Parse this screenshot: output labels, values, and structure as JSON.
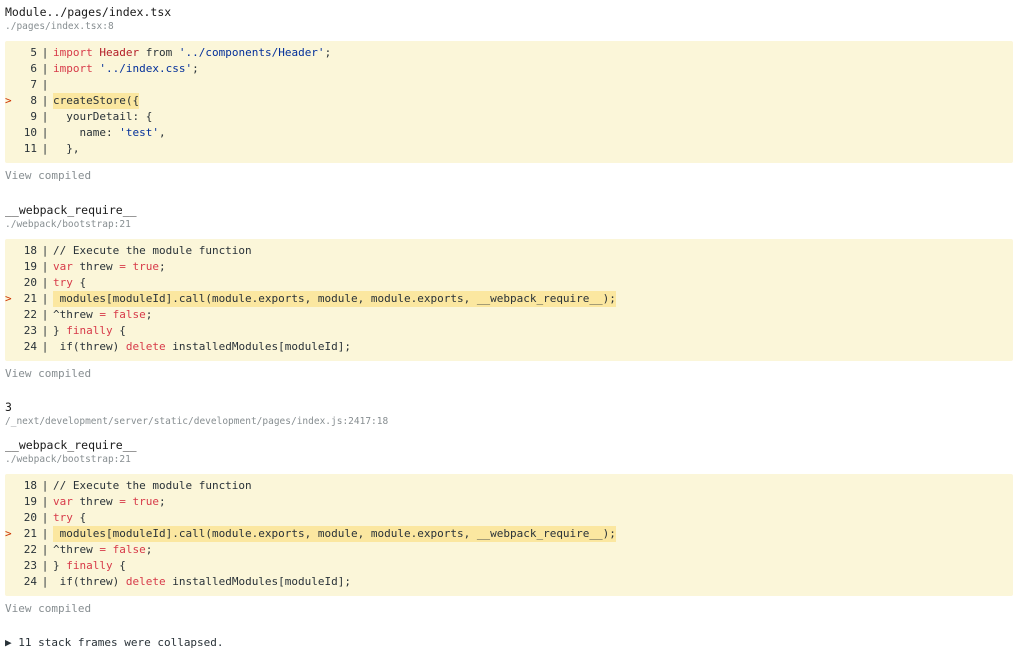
{
  "frames": [
    {
      "title": "Module../pages/index.tsx",
      "location": "./pages/index.tsx:8",
      "lines": [
        {
          "num": "5",
          "highlighted": false,
          "tokens": [
            {
              "t": "import ",
              "c": "kw"
            },
            {
              "t": "Header",
              "c": "ty"
            },
            {
              "t": " from ",
              "c": "plain"
            },
            {
              "t": "'../components/Header'",
              "c": "st"
            },
            {
              "t": ";",
              "c": "plain"
            }
          ]
        },
        {
          "num": "6",
          "highlighted": false,
          "tokens": [
            {
              "t": "import ",
              "c": "kw"
            },
            {
              "t": "'../index.css'",
              "c": "st"
            },
            {
              "t": ";",
              "c": "plain"
            }
          ]
        },
        {
          "num": "7",
          "highlighted": false,
          "tokens": []
        },
        {
          "num": "8",
          "highlighted": true,
          "tokens": [
            {
              "t": "createStore({",
              "c": "plain"
            }
          ]
        },
        {
          "num": "9",
          "highlighted": false,
          "tokens": [
            {
              "t": "  yourDetail: {",
              "c": "plain"
            }
          ]
        },
        {
          "num": "10",
          "highlighted": false,
          "tokens": [
            {
              "t": "    name: ",
              "c": "plain"
            },
            {
              "t": "'test'",
              "c": "st"
            },
            {
              "t": ",",
              "c": "plain"
            }
          ]
        },
        {
          "num": "11",
          "highlighted": false,
          "tokens": [
            {
              "t": "  },",
              "c": "plain"
            }
          ]
        }
      ],
      "view_compiled": "View compiled"
    },
    {
      "title": "__webpack_require__",
      "location": "./webpack/bootstrap:21",
      "lines": [
        {
          "num": "18",
          "highlighted": false,
          "tokens": [
            {
              "t": "// Execute the module function",
              "c": "plain"
            }
          ]
        },
        {
          "num": "19",
          "highlighted": false,
          "tokens": [
            {
              "t": "var ",
              "c": "kw"
            },
            {
              "t": "threw ",
              "c": "plain"
            },
            {
              "t": "= ",
              "c": "kw"
            },
            {
              "t": "true",
              "c": "kw"
            },
            {
              "t": ";",
              "c": "plain"
            }
          ]
        },
        {
          "num": "20",
          "highlighted": false,
          "tokens": [
            {
              "t": "try ",
              "c": "kw"
            },
            {
              "t": "{",
              "c": "plain"
            }
          ]
        },
        {
          "num": "21",
          "highlighted": true,
          "tokens": [
            {
              "t": " modules[moduleId].call(module.exports, module, module.exports, __webpack_require__);",
              "c": "plain"
            }
          ]
        },
        {
          "num": "22",
          "highlighted": false,
          "tokens": [
            {
              "t": "^threw ",
              "c": "plain"
            },
            {
              "t": "= ",
              "c": "kw"
            },
            {
              "t": "false",
              "c": "kw"
            },
            {
              "t": ";",
              "c": "plain"
            }
          ]
        },
        {
          "num": "23",
          "highlighted": false,
          "tokens": [
            {
              "t": "} ",
              "c": "plain"
            },
            {
              "t": "finally ",
              "c": "kw"
            },
            {
              "t": "{",
              "c": "plain"
            }
          ]
        },
        {
          "num": "24",
          "highlighted": false,
          "tokens": [
            {
              "t": " if(threw) ",
              "c": "plain"
            },
            {
              "t": "delete ",
              "c": "kw"
            },
            {
              "t": "installedModules[moduleId];",
              "c": "plain"
            }
          ]
        }
      ],
      "view_compiled": "View compiled"
    },
    {
      "title": "3",
      "location": "/_next/development/server/static/development/pages/index.js:2417:18",
      "lines": [],
      "view_compiled": ""
    },
    {
      "title": "__webpack_require__",
      "location": "./webpack/bootstrap:21",
      "lines": [
        {
          "num": "18",
          "highlighted": false,
          "tokens": [
            {
              "t": "// Execute the module function",
              "c": "plain"
            }
          ]
        },
        {
          "num": "19",
          "highlighted": false,
          "tokens": [
            {
              "t": "var ",
              "c": "kw"
            },
            {
              "t": "threw ",
              "c": "plain"
            },
            {
              "t": "= ",
              "c": "kw"
            },
            {
              "t": "true",
              "c": "kw"
            },
            {
              "t": ";",
              "c": "plain"
            }
          ]
        },
        {
          "num": "20",
          "highlighted": false,
          "tokens": [
            {
              "t": "try ",
              "c": "kw"
            },
            {
              "t": "{",
              "c": "plain"
            }
          ]
        },
        {
          "num": "21",
          "highlighted": true,
          "tokens": [
            {
              "t": " modules[moduleId].call(module.exports, module, module.exports, __webpack_require__);",
              "c": "plain"
            }
          ]
        },
        {
          "num": "22",
          "highlighted": false,
          "tokens": [
            {
              "t": "^threw ",
              "c": "plain"
            },
            {
              "t": "= ",
              "c": "kw"
            },
            {
              "t": "false",
              "c": "kw"
            },
            {
              "t": ";",
              "c": "plain"
            }
          ]
        },
        {
          "num": "23",
          "highlighted": false,
          "tokens": [
            {
              "t": "} ",
              "c": "plain"
            },
            {
              "t": "finally ",
              "c": "kw"
            },
            {
              "t": "{",
              "c": "plain"
            }
          ]
        },
        {
          "num": "24",
          "highlighted": false,
          "tokens": [
            {
              "t": " if(threw) ",
              "c": "plain"
            },
            {
              "t": "delete ",
              "c": "kw"
            },
            {
              "t": "installedModules[moduleId];",
              "c": "plain"
            }
          ]
        }
      ],
      "view_compiled": "View compiled"
    }
  ],
  "collapsed": {
    "toggle_glyph": "▶",
    "label": "11 stack frames were collapsed."
  },
  "colors": {
    "code_background": "#fbf6d9",
    "highlight_line": "#fbe7a0",
    "keyword": "#d73a49",
    "string": "#032f9a",
    "muted": "#878e91",
    "marker": "#cc3300"
  },
  "marker_glyph": ">",
  "separator": "|"
}
